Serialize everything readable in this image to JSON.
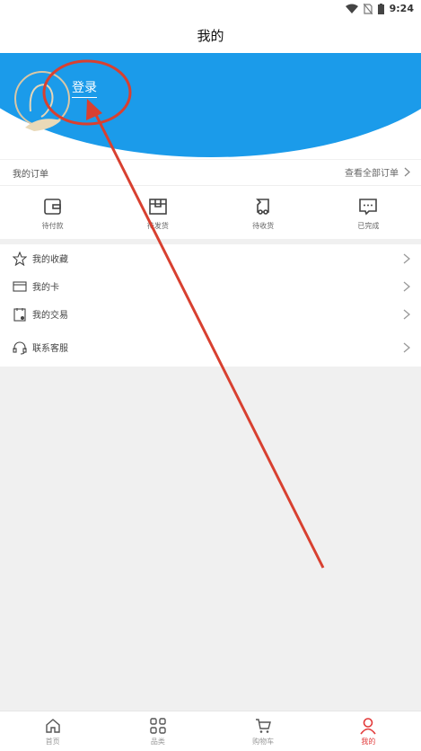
{
  "status": {
    "time": "9:24"
  },
  "header": {
    "title": "我的"
  },
  "profile": {
    "login_label": "登录"
  },
  "orders": {
    "title": "我的订单",
    "view_all": "查看全部订单",
    "items": [
      {
        "label": "待付款",
        "icon": "wallet-icon"
      },
      {
        "label": "待发货",
        "icon": "box-icon"
      },
      {
        "label": "待收货",
        "icon": "truck-icon"
      },
      {
        "label": "已完成",
        "icon": "message-icon"
      }
    ]
  },
  "menu": {
    "items": [
      {
        "label": "我的收藏",
        "icon": "star-icon"
      },
      {
        "label": "我的卡",
        "icon": "card-icon"
      },
      {
        "label": "我的交易",
        "icon": "trade-icon"
      },
      {
        "label": "联系客服",
        "icon": "headset-icon"
      }
    ]
  },
  "tabbar": {
    "items": [
      {
        "label": "首页",
        "icon": "home-icon"
      },
      {
        "label": "品类",
        "icon": "grid-icon"
      },
      {
        "label": "购物车",
        "icon": "cart-icon"
      },
      {
        "label": "我的",
        "icon": "user-icon"
      }
    ]
  },
  "colors": {
    "brand_blue": "#1b9bea",
    "accent_red": "#e23a3a",
    "annotation_red": "#d84030"
  }
}
